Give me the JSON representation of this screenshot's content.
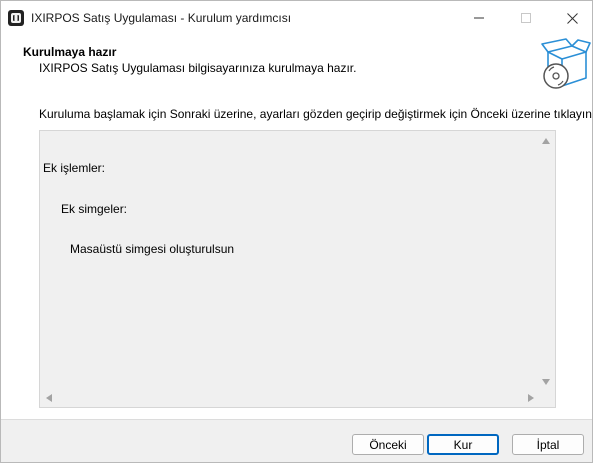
{
  "window": {
    "title": "IXIRPOS Satış Uygulaması - Kurulum yardımcısı",
    "icon": "app-logo-icon",
    "controls": {
      "minimize_icon": "minimize-icon",
      "maximize_icon": "maximize-icon",
      "close_icon": "close-icon"
    }
  },
  "header": {
    "title": "Kurulmaya hazır",
    "subtitle": "IXIRPOS Satış Uygulaması bilgisayarınıza kurulmaya hazır.",
    "icon": "setup-box-icon"
  },
  "content": {
    "intro": "Kuruluma başlamak için Sonraki üzerine, ayarları gözden geçirip değiştirmek için Önceki üzerine tıklayın.",
    "memo_lines": [
      "Ek işlemler:",
      "Ek simgeler:",
      "Masaüstü simgesi oluşturulsun"
    ]
  },
  "buttons": {
    "back": "Önceki",
    "next": "Kur",
    "cancel": "İptal"
  },
  "colors": {
    "accent": "#0067c0",
    "panel": "#f0f0f0",
    "white": "#ffffff"
  }
}
